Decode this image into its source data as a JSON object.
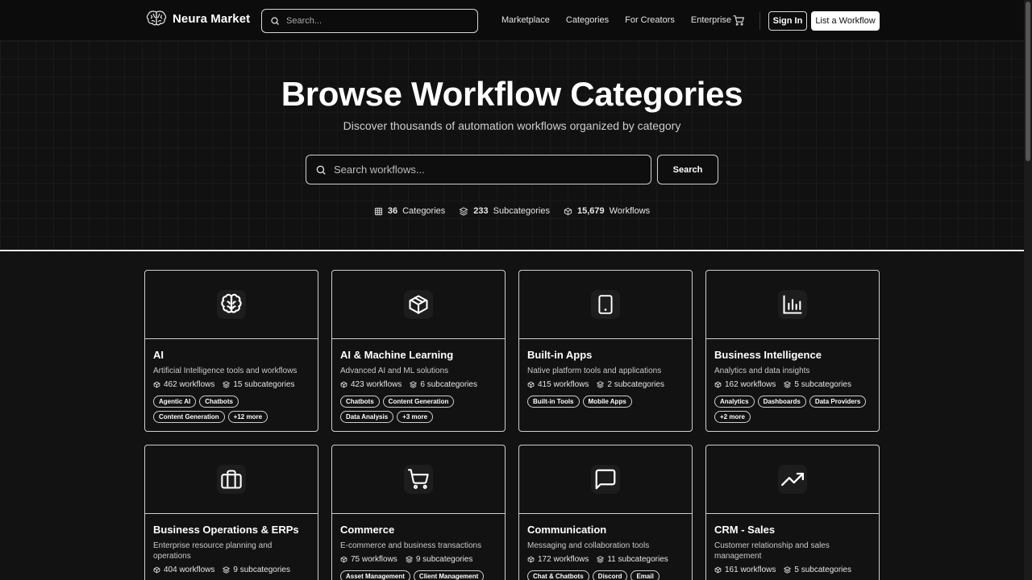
{
  "nav": {
    "brand": "Neura Market",
    "search_placeholder": "Search...",
    "links": [
      "Marketplace",
      "Categories",
      "For Creators",
      "Enterprise"
    ],
    "signin": "Sign In",
    "list_workflow": "List a Workflow"
  },
  "hero": {
    "title": "Browse Workflow Categories",
    "subtitle": "Discover thousands of automation workflows organized by category",
    "search_placeholder": "Search workflows...",
    "search_button": "Search",
    "stats": {
      "categories_count": "36",
      "categories_label": "Categories",
      "subcategories_count": "233",
      "subcategories_label": "Subcategories",
      "workflows_count": "15,679",
      "workflows_label": "Workflows"
    }
  },
  "categories": [
    {
      "icon": "brain-icon",
      "title": "AI",
      "desc": "Artificial Intelligence tools and workflows",
      "workflows": "462 workflows",
      "subcats": "15 subcategories",
      "tags": [
        "Agentic AI",
        "Chatbots",
        "Content Generation",
        "+12 more"
      ]
    },
    {
      "icon": "box-icon",
      "title": "AI & Machine Learning",
      "desc": "Advanced AI and ML solutions",
      "workflows": "423 workflows",
      "subcats": "6 subcategories",
      "tags": [
        "Chatbots",
        "Content Generation",
        "Data Analysis",
        "+3 more"
      ]
    },
    {
      "icon": "tablet-icon",
      "title": "Built-in Apps",
      "desc": "Native platform tools and applications",
      "workflows": "415 workflows",
      "subcats": "2 subcategories",
      "tags": [
        "Built-in Tools",
        "Mobile Apps"
      ]
    },
    {
      "icon": "bar-chart-icon",
      "title": "Business Intelligence",
      "desc": "Analytics and data insights",
      "workflows": "162 workflows",
      "subcats": "5 subcategories",
      "tags": [
        "Analytics",
        "Dashboards",
        "Data Providers",
        "+2 more"
      ]
    },
    {
      "icon": "briefcase-icon",
      "title": "Business Operations & ERPs",
      "desc": "Enterprise resource planning and operations",
      "workflows": "404 workflows",
      "subcats": "9 subcategories",
      "tags": []
    },
    {
      "icon": "shopping-cart-icon",
      "title": "Commerce",
      "desc": "E-commerce and business transactions",
      "workflows": "75 workflows",
      "subcats": "9 subcategories",
      "tags": [
        "Asset Management",
        "Client Management"
      ]
    },
    {
      "icon": "message-square-icon",
      "title": "Communication",
      "desc": "Messaging and collaboration tools",
      "workflows": "172 workflows",
      "subcats": "11 subcategories",
      "tags": [
        "Chat & Chatbots",
        "Discord",
        "Email"
      ]
    },
    {
      "icon": "trending-up-icon",
      "title": "CRM - Sales",
      "desc": "Customer relationship and sales management",
      "workflows": "161 workflows",
      "subcats": "5 subcategories",
      "tags": []
    }
  ]
}
